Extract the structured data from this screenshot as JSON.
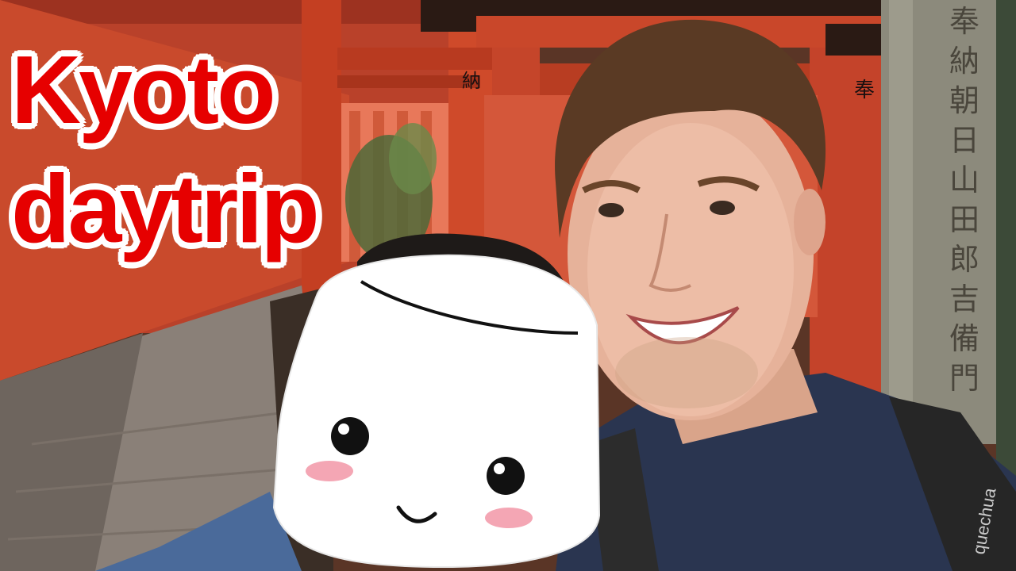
{
  "thumbnail": {
    "title_line1": "Kyoto",
    "title_line2": "daytrip",
    "title_color": "#e60000",
    "title_outline_color": "#ffffff"
  },
  "gate_signs": [
    "納",
    "奉"
  ],
  "pillar_inscription": "奉納朝日山田郎吉備門",
  "backpack_brand": "quechua",
  "colors": {
    "torii_red": "#c8431f",
    "path_stone": "#8a8078",
    "shirt_navy": "#2a3550",
    "marshmallow": "#ffffff",
    "blush": "#f4a6b4"
  }
}
